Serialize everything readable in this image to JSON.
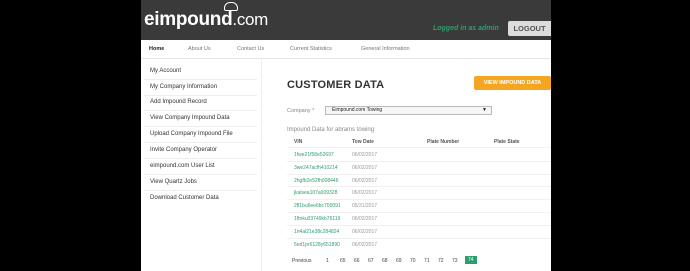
{
  "header": {
    "logo_e": "e",
    "logo_impound": "impound",
    "logo_suffix": ".com",
    "logged_in": "Logged in as admin",
    "logout": "LOGOUT",
    "brand_color": "#2e9e6e"
  },
  "nav": {
    "items": [
      "Home",
      "About Us",
      "Contact Us",
      "Current Statistics",
      "General Information"
    ]
  },
  "sidebar": {
    "items": [
      "My Account",
      "My Company Information",
      "Add Impound Record",
      "View Company Impound Data",
      "Upload Company Impound File",
      "Invite Company Operator",
      "eimpound.com User List",
      "View Quartz Jobs",
      "Download Customer Data"
    ]
  },
  "main": {
    "title": "CUSTOMER DATA",
    "view_button": "VIEW IMPOUND DATA",
    "company_label": "Company *",
    "company_value": "Eimpound.com Towing",
    "subtitle": "Impound Data for abrams towing",
    "columns": [
      "VIN",
      "Tow Date",
      "Plate Number",
      "Plate State"
    ],
    "rows": [
      {
        "vin": "1fwe21f58e52697",
        "date": "06/02/2017"
      },
      {
        "vin": "3we247acfh410214",
        "date": "06/02/2017"
      },
      {
        "vin": "2hgfb2e52fh008446",
        "date": "06/02/2017"
      },
      {
        "vin": "jkalsea107a009328",
        "date": "06/02/2017"
      },
      {
        "vin": "2fl1bu6ee6bc700091",
        "date": "05/31/2017"
      },
      {
        "vin": "1ftnku03749kb76119",
        "date": "06/02/2017"
      },
      {
        "vin": "1n4al21e38c284824",
        "date": "06/02/2017"
      },
      {
        "vin": "5nd1pr6128y651890",
        "date": "06/02/2017"
      }
    ],
    "pager": [
      "Previous",
      "1",
      "65",
      "66",
      "67",
      "68",
      "69",
      "70",
      "71",
      "72",
      "73",
      "74"
    ],
    "pager_active": "74"
  }
}
